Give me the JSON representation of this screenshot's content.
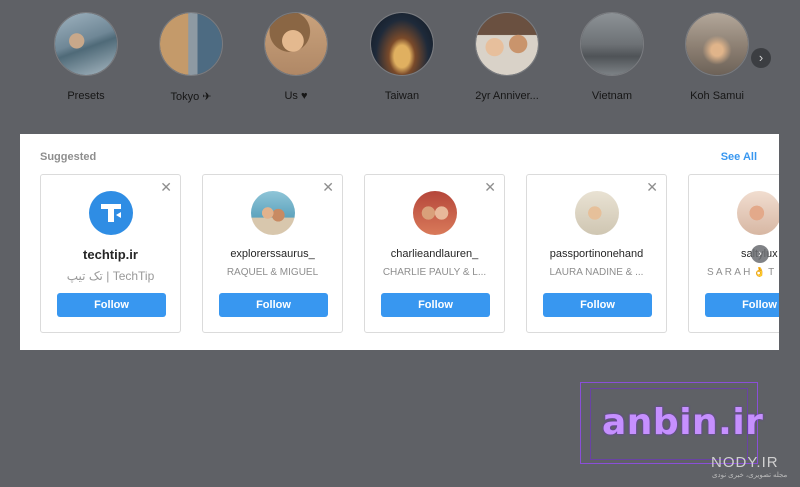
{
  "highlights": {
    "items": [
      {
        "label": "Presets"
      },
      {
        "label": "Tokyo ✈"
      },
      {
        "label": "Us ♥"
      },
      {
        "label": "Taiwan"
      },
      {
        "label": "2yr Anniver..."
      },
      {
        "label": "Vietnam"
      },
      {
        "label": "Koh Samui"
      }
    ],
    "next_icon": "chevron-right-icon"
  },
  "suggested": {
    "title": "Suggested",
    "see_all": "See All",
    "cards": [
      {
        "username": "techtip.ir",
        "subtitle": "تک تیپ | TechTip",
        "follow": "Follow"
      },
      {
        "username": "explorerssaurus_",
        "subtitle": "RAQUEL & MIGUEL",
        "follow": "Follow"
      },
      {
        "username": "charlieandlauren_",
        "subtitle": "CHARLIE PAULY & L...",
        "follow": "Follow"
      },
      {
        "username": "passportinonehand",
        "subtitle": "LAURA NADINE & ...",
        "follow": "Follow"
      },
      {
        "username": "saltylux",
        "subtitle": "S A R A H 👌 T",
        "follow": "Follow"
      }
    ],
    "close_icon": "close-icon",
    "next_icon": "chevron-right-icon"
  },
  "watermark": {
    "brand": "anbin.ir",
    "nody": "NODY.IR",
    "tagline": "مجله تصویری، خبری نودی"
  },
  "colors": {
    "background": "#5f6166",
    "follow_button": "#3897f0",
    "see_all": "#3897f0",
    "watermark": "#c690ff"
  }
}
